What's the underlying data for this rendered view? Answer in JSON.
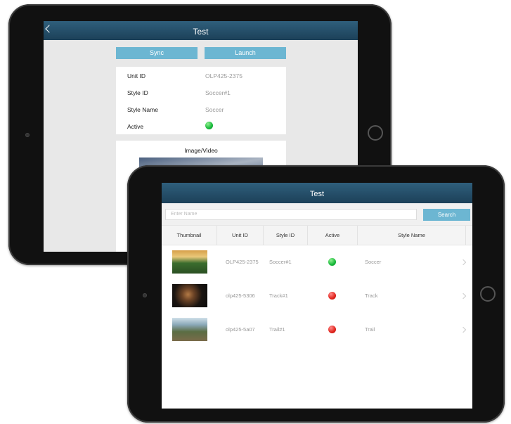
{
  "back_app": {
    "title": "Test",
    "buttons": {
      "sync": "Sync",
      "launch": "Launch"
    },
    "details": [
      {
        "label": "Unit ID",
        "value": "OLP425-2375"
      },
      {
        "label": "Style ID",
        "value": "Soccer#1"
      },
      {
        "label": "Style Name",
        "value": "Soccer"
      },
      {
        "label": "Active",
        "status": "green"
      }
    ],
    "media_title": "Image/Video"
  },
  "front_app": {
    "title": "Test",
    "search": {
      "placeholder": "Enter Name",
      "button": "Search"
    },
    "columns": [
      "Thumbnail",
      "Unit ID",
      "Style ID",
      "Active",
      "Style Name"
    ],
    "rows": [
      {
        "unit_id": "OLP425-2375",
        "style_id": "Soccer#1",
        "active": "green",
        "style_name": "Soccer"
      },
      {
        "unit_id": "olp425-5306",
        "style_id": "Track#1",
        "active": "red",
        "style_name": "Track"
      },
      {
        "unit_id": "olp425-5a07",
        "style_id": "Trail#1",
        "active": "red",
        "style_name": "Trail"
      }
    ]
  },
  "colors": {
    "header": "#1f4a66",
    "accent": "#6cb6d2",
    "active_green": "#1db83f",
    "inactive_red": "#e0241c"
  },
  "icons": [
    "back-chevron-icon",
    "row-chevron-icon",
    "status-dot-icon"
  ]
}
